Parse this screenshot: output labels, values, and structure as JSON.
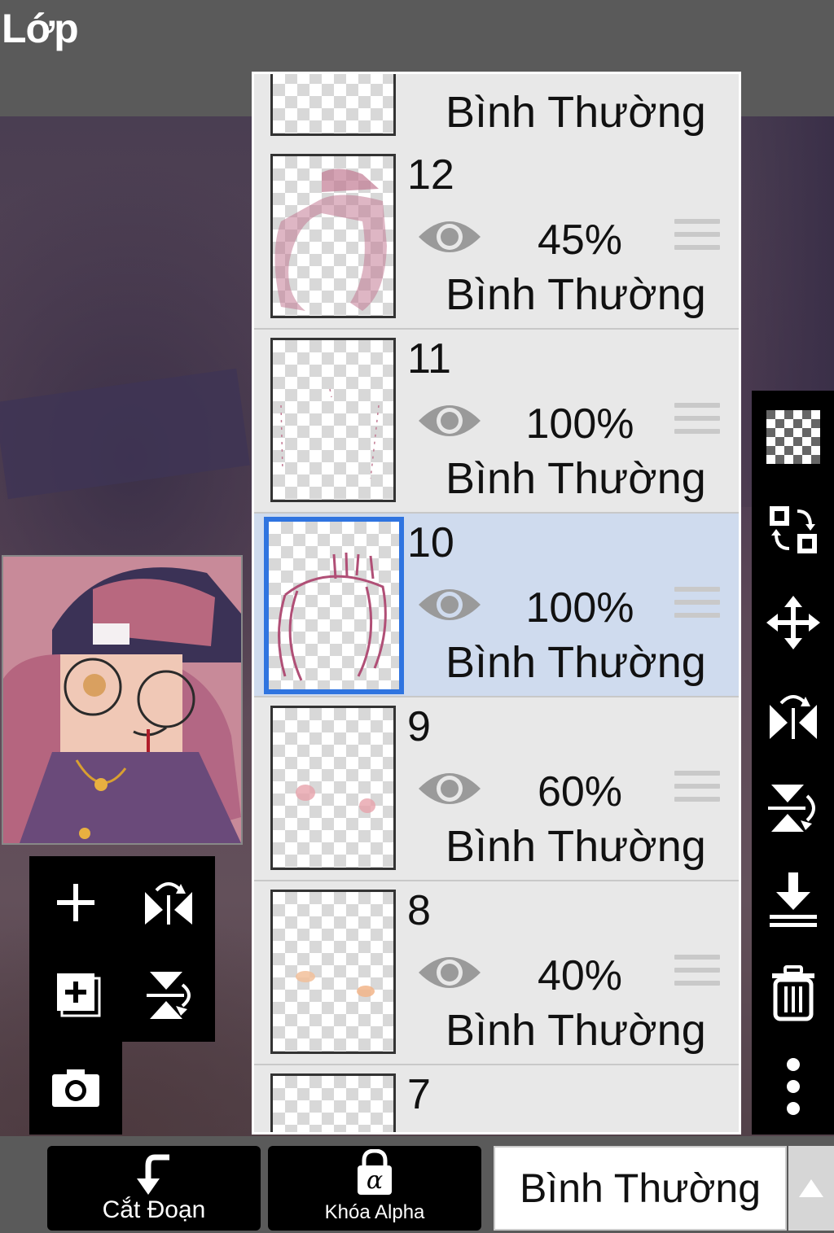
{
  "header": {
    "title": "Lớp"
  },
  "layers": [
    {
      "number": "",
      "opacity": "",
      "blend": "Bình Thường",
      "partial": "top"
    },
    {
      "number": "12",
      "opacity": "45%",
      "blend": "Bình Thường"
    },
    {
      "number": "11",
      "opacity": "100%",
      "blend": "Bình Thường"
    },
    {
      "number": "10",
      "opacity": "100%",
      "blend": "Bình Thường",
      "selected": true
    },
    {
      "number": "9",
      "opacity": "60%",
      "blend": "Bình Thường"
    },
    {
      "number": "8",
      "opacity": "40%",
      "blend": "Bình Thường"
    },
    {
      "number": "7",
      "opacity": "",
      "blend": "",
      "partial": "bottom"
    }
  ],
  "left_tools": {
    "icons": [
      "plus-icon",
      "flip-horizontal-icon",
      "duplicate-layer-icon",
      "flip-vertical-icon",
      "camera-icon"
    ]
  },
  "right_toolbar": {
    "icons": [
      "transparency-icon",
      "swap-icon",
      "move-icon",
      "flip-horizontal-icon",
      "flip-vertical-icon",
      "merge-down-icon",
      "trash-icon",
      "more-icon"
    ]
  },
  "bottom": {
    "clip_label": "Cắt Đoạn",
    "alpha_lock_label": "Khóa Alpha",
    "blend_mode": "Bình Thường"
  },
  "colors": {
    "selected_row": "#cfdbee",
    "selected_border": "#2f74e0",
    "toolbar": "#000000",
    "header": "#5a5a5a"
  }
}
